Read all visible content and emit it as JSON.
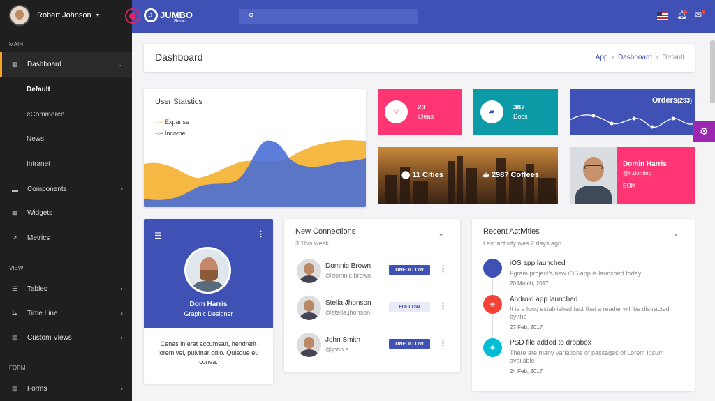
{
  "user": {
    "name": "Robert Johnson"
  },
  "sidebar": {
    "section_main": "MAIN",
    "section_view": "VIEW",
    "section_form": "FORM",
    "dashboard": "Dashboard",
    "subs": [
      "Default",
      "eCommerce",
      "News",
      "Intranet"
    ],
    "components": "Components",
    "widgets": "Widgets",
    "metrics": "Metrics",
    "tables": "Tables",
    "timeline": "Time Line",
    "custom_views": "Custom Views",
    "forms": "Forms"
  },
  "topbar": {
    "logo": "JUMBO",
    "logo_sub": "React"
  },
  "page": {
    "title": "Dashboard",
    "crumbs": [
      "App",
      "Dashboard",
      "Default"
    ]
  },
  "stats": {
    "title": "User Statstics",
    "legend": [
      "Expanse",
      "Income"
    ],
    "colors": {
      "expanse": "#f5b843",
      "income": "#4a6fd5"
    }
  },
  "tiles": {
    "ideas_value": "23",
    "ideas_label": "iDeas",
    "docs_value": "387",
    "docs_label": "Docs",
    "orders_label": "Orders",
    "orders_count": "(293)",
    "cities": "11 Cities",
    "coffees": "2987 Coffees"
  },
  "contact": {
    "name": "Domin Harris",
    "handle": "@h.dominc",
    "org": "EOM"
  },
  "profile": {
    "name": "Dom Harris",
    "role": "Graphic Designer",
    "bio": "Cenas in erat accumsan, hendrerit lorem vel, pulvinar odio. Quisque eu conva."
  },
  "connections": {
    "title": "New Connections",
    "subtitle": "3 This week",
    "people": [
      {
        "name": "Domnic Brown",
        "handle": "@domnic.brown",
        "action": "UNFOLLOW"
      },
      {
        "name": "Stella Jhonson",
        "handle": "@stella.jhonson",
        "action": "FOLLOW"
      },
      {
        "name": "John Smith",
        "handle": "@john.s",
        "action": "UNFOLLOW"
      }
    ]
  },
  "activities": {
    "title": "Recent Activities",
    "subtitle": "Last activity was 2 days ago",
    "items": [
      {
        "title": "iOS app launched",
        "desc": "Fgram project's new iOS app is launched today",
        "date": "20 March, 2017"
      },
      {
        "title": "Android app launched",
        "desc": "It is a long established fact that a reader will be distracted by the",
        "date": "27 Feb, 2017"
      },
      {
        "title": "PSD file added to dropbox",
        "desc": "There are many variations of passages of Lorem Ipsum available",
        "date": "24 Feb, 2017"
      }
    ]
  }
}
